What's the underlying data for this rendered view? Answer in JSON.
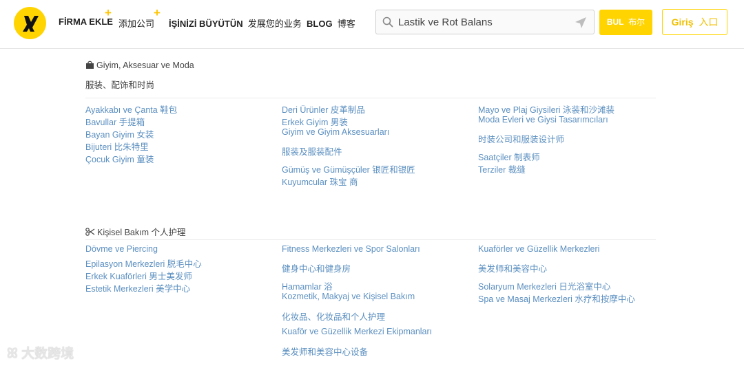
{
  "header": {
    "nav": [
      {
        "label": "FİRMA EKLE",
        "cn": "添加公司"
      },
      {
        "label": "İŞİNİZİ BÜYÜTÜN",
        "cn": "发展您的业务"
      },
      {
        "label": "BLOG",
        "cn": "博客"
      }
    ],
    "plus": "+",
    "search_value": "Lastik ve Rot Balans",
    "search_button": {
      "label": "BUL",
      "cn": "布尔"
    },
    "login_button": {
      "label": "Giriş",
      "cn": "入口"
    },
    "colors": {
      "brand": "#ffd400",
      "link": "#5b8fc0"
    }
  },
  "categories": [
    {
      "icon": "shopping-bag-icon",
      "title": "Giyim, Aksesuar ve Moda",
      "subtitle": "服装、配饰和时尚",
      "columns": [
        [
          "Ayakkabı ve Çanta  鞋包",
          "Bavullar  手提箱",
          "Bayan Giyim  女装",
          "Bijuteri  比朱特里",
          "Çocuk Giyim  童装"
        ],
        [
          "Deri Ürünler  皮革制品",
          "Erkek Giyim  男装",
          "Giyim ve Giyim Aksesuarları",
          "服装及服装配件",
          "Gümüş ve Gümüşçüler  银匠和银匠",
          "Kuyumcular  珠宝 商"
        ],
        [
          "Mayo ve Plaj Giysileri  泳装和沙滩装",
          "Moda Evleri ve Giysi Tasarımcıları",
          "时装公司和服装设计师",
          "Saatçiler  制表师",
          "Terziler  裁缝"
        ]
      ]
    },
    {
      "icon": "scissors-icon",
      "title": "Kişisel Bakım  个人护理",
      "columns": [
        [
          "Dövme ve Piercing",
          "Epilasyon Merkezleri  脱毛中心",
          "Erkek Kuaförleri  男士美发师",
          "Estetik Merkezleri  美学中心"
        ],
        [
          "Fitness Merkezleri ve Spor Salonları",
          "健身中心和健身房",
          "Hamamlar  浴",
          "Kozmetik, Makyaj ve Kişisel Bakım",
          "化妆品、化妆品和个人护理",
          "Kuaför ve Güzellik Merkezi Ekipmanları",
          "美发师和美容中心设备"
        ],
        [
          "Kuaförler ve Güzellik Merkezleri",
          "美发师和美容中心",
          "Solaryum Merkezleri  日光浴室中心",
          "Spa ve Masaj Merkezleri  水疗和按摩中心"
        ]
      ]
    }
  ],
  "watermark": "大数跨境"
}
